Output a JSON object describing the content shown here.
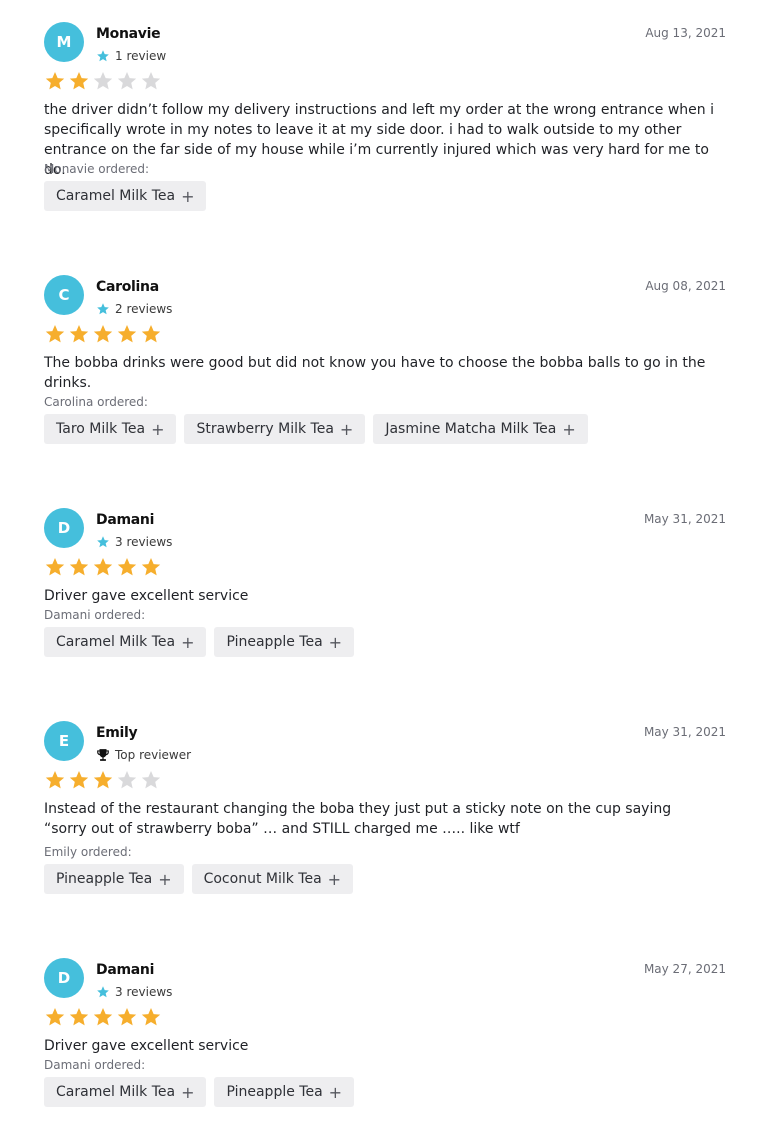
{
  "reviews": [
    {
      "initial": "M",
      "name": "Monavie",
      "badge_icon": "star-icon",
      "badge_text": "1 review",
      "date": "Aug 13, 2021",
      "rating": 2,
      "text": "the driver didn’t follow my delivery instructions and left my order at the wrong entrance when i specifically wrote in my notes to leave it at my side door. i had to walk outside to my other entrance on the far side of my house while i’m currently injured which was very hard for me to do.",
      "ordered_label": "Monavie ordered:",
      "items": [
        "Caramel Milk Tea",
        "+"
      ]
    },
    {
      "initial": "C",
      "name": "Carolina",
      "badge_icon": "star-icon",
      "badge_text": "2 reviews",
      "date": "Aug 08, 2021",
      "rating": 5,
      "text": "The bobba drinks were good but did not know you have to choose the bobba balls to go in the drinks.",
      "ordered_label": "Carolina ordered:",
      "items": [
        "Taro Milk Tea",
        "Strawberry Milk Tea",
        "Jasmine Matcha Milk Tea"
      ]
    },
    {
      "initial": "D",
      "name": "Damani",
      "badge_icon": "star-icon",
      "badge_text": "3 reviews",
      "date": "May 31, 2021",
      "rating": 5,
      "text": "Driver gave excellent service",
      "ordered_label": "Damani ordered:",
      "items": [
        "Caramel Milk Tea",
        "Pineapple Tea"
      ]
    },
    {
      "initial": "E",
      "name": "Emily",
      "badge_icon": "trophy-icon",
      "badge_text": "Top reviewer",
      "date": "May 31, 2021",
      "rating": 3,
      "text": "Instead of the restaurant changing the boba they just put a sticky note on the cup saying “sorry out of strawberry boba” … and STILL charged me ….. like wtf",
      "ordered_label": "Emily ordered:",
      "items": [
        "Pineapple Tea",
        "Coconut Milk Tea"
      ]
    },
    {
      "initial": "D",
      "name": "Damani",
      "badge_icon": "star-icon",
      "badge_text": "3 reviews",
      "date": "May 27, 2021",
      "rating": 5,
      "text": "Driver gave excellent service",
      "ordered_label": "Damani ordered:",
      "items": [
        "Caramel Milk Tea",
        "Pineapple Tea"
      ]
    }
  ],
  "chip_plus": "+",
  "colors": {
    "avatar": "#45bfdc",
    "star_filled": "#f6ae2d",
    "star_empty": "#d9d9db",
    "badge_star": "#45bfdc",
    "chip_bg": "#eeeef0"
  }
}
